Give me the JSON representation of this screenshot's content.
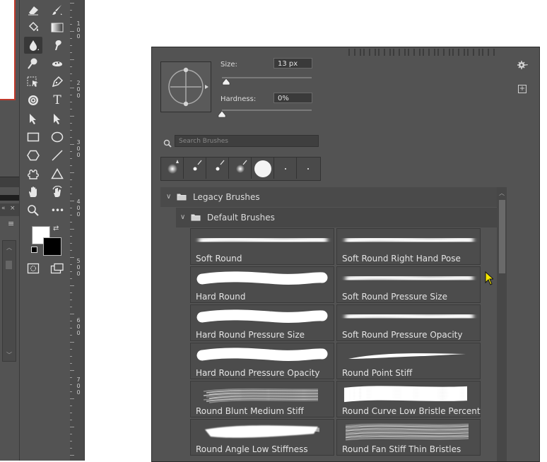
{
  "toolbar": {
    "icons": [
      "eraser-icon",
      "brush-icon",
      "paint-bucket-icon",
      "gradient-icon",
      "blur-drop-icon",
      "smudge-icon",
      "dodge-icon",
      "sponge-icon",
      "object-select-icon",
      "pen-icon",
      "stamp-icon",
      "type-icon",
      "path-select-icon",
      "direct-select-icon",
      "rectangle-icon",
      "ellipse-icon",
      "polygon-icon",
      "line-icon",
      "custom-shape-icon",
      "triangle-icon",
      "hand-icon",
      "rotate-view-icon",
      "zoom-icon",
      "more-tools-icon"
    ],
    "type_label": "T",
    "more_label": "•••"
  },
  "ruler": {
    "labels": [
      "1",
      "0",
      "0",
      "2",
      "0",
      "0",
      "3",
      "0",
      "0",
      "4",
      "0",
      "0",
      "5",
      "0",
      "0",
      "6",
      "0",
      "0",
      "7",
      "0",
      "0"
    ]
  },
  "panel": {
    "size_label": "Size:",
    "size_value": "13 px",
    "size_fraction": 0.03,
    "hardness_label": "Hardness:",
    "hardness_value": "0%",
    "hardness_fraction": 0.0,
    "search_placeholder": "Search Brushes",
    "recent_brushes": [
      "soft-round",
      "hard-small",
      "hard-small",
      "soft-medium",
      "hard-large",
      "dot",
      "dot"
    ],
    "groups": [
      {
        "label": "Legacy Brushes",
        "expanded": true
      },
      {
        "label": "Default Brushes",
        "expanded": true
      }
    ],
    "brushes": [
      {
        "name": "Soft Round",
        "style": "soft"
      },
      {
        "name": "Soft Round Right Hand Pose",
        "style": "soft"
      },
      {
        "name": "Hard Round",
        "style": "hard"
      },
      {
        "name": "Soft Round Pressure Size",
        "style": "soft-taper"
      },
      {
        "name": "Hard Round Pressure Size",
        "style": "hard"
      },
      {
        "name": "Soft Round Pressure Opacity",
        "style": "soft"
      },
      {
        "name": "Hard Round Pressure Opacity",
        "style": "hard"
      },
      {
        "name": "Round Point Stiff",
        "style": "thin"
      },
      {
        "name": "Round Blunt Medium Stiff",
        "style": "bristle"
      },
      {
        "name": "Round Curve Low Bristle Percent",
        "style": "bristle-white"
      },
      {
        "name": "Round Angle Low Stiffness",
        "style": "rough"
      },
      {
        "name": "Round Fan Stiff Thin Bristles",
        "style": "fan"
      }
    ]
  },
  "colors": {
    "panel_bg": "#535353",
    "foreground": "#ffffff",
    "background": "#000000",
    "accent_cursor": "#f5e600"
  }
}
